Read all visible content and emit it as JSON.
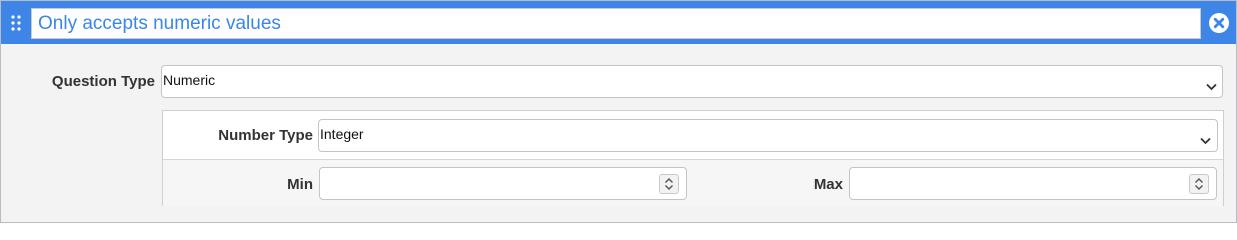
{
  "header": {
    "title_value": "Only accepts numeric values",
    "icons": {
      "drag": "drag-handle-icon",
      "close": "close-circle-icon"
    },
    "colors": {
      "header_bg": "#3d86e8",
      "title_text": "#3a86e6"
    }
  },
  "question_type": {
    "label": "Question Type",
    "selected": "Numeric"
  },
  "number_type": {
    "label": "Number Type",
    "selected": "Integer"
  },
  "min": {
    "label": "Min",
    "value": ""
  },
  "max": {
    "label": "Max",
    "value": ""
  }
}
